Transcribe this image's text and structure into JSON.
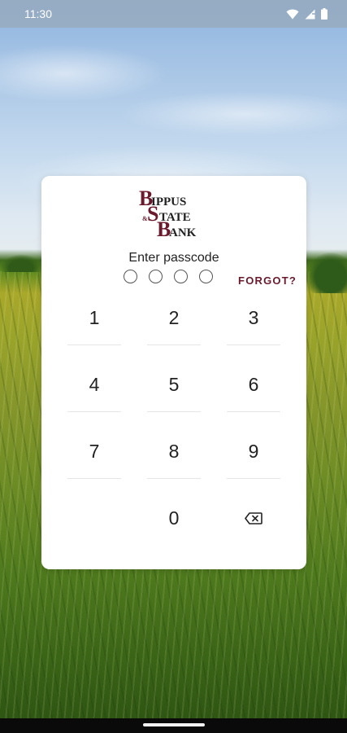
{
  "status_bar": {
    "time": "11:30",
    "icons": [
      "wifi-icon",
      "signal-icon",
      "battery-icon"
    ]
  },
  "logo": {
    "lines": [
      "BIPPUS",
      "STATE",
      "BANK"
    ],
    "initials": [
      "B",
      "S",
      "B"
    ],
    "rest": [
      "IPPUS",
      "TATE",
      "ANK"
    ],
    "connector": "&",
    "brand_color": "#6b1a2e"
  },
  "passcode": {
    "prompt": "Enter passcode",
    "digits_entered": 0,
    "length": 4,
    "forgot_label": "FORGOT?"
  },
  "keypad": {
    "keys": [
      "1",
      "2",
      "3",
      "4",
      "5",
      "6",
      "7",
      "8",
      "9",
      "",
      "0",
      "backspace"
    ],
    "backspace_icon": "backspace-icon"
  },
  "colors": {
    "accent": "#6b1a2e",
    "card_background": "#ffffff"
  }
}
